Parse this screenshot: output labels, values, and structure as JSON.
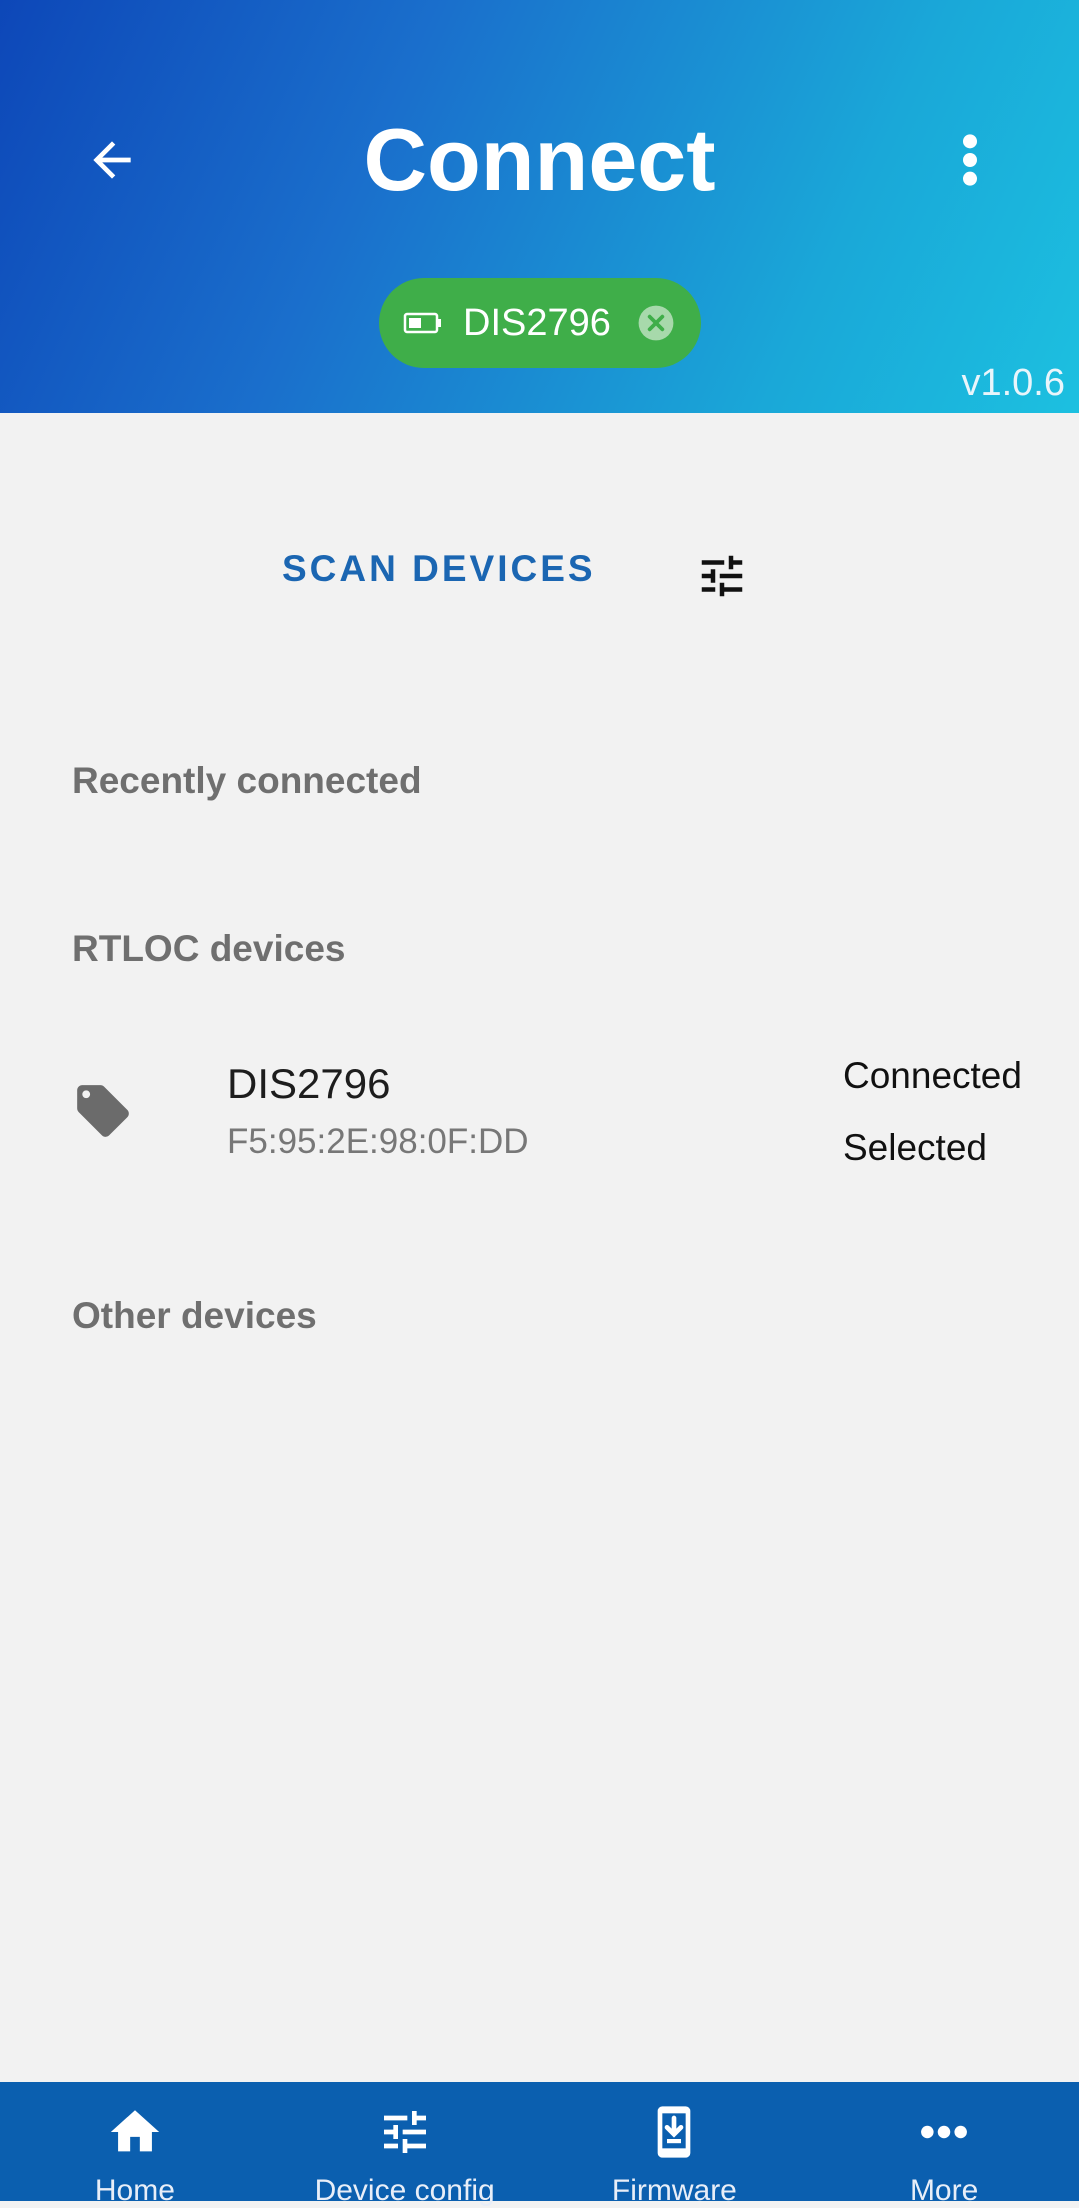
{
  "header": {
    "title": "Connect",
    "chip_label": "DIS2796",
    "version": "v1.0.6"
  },
  "scan": {
    "label": "SCAN DEVICES"
  },
  "sections": {
    "recent": "Recently connected",
    "rtloc": "RTLOC devices",
    "other": "Other devices"
  },
  "devices": [
    {
      "name": "DIS2796",
      "mac": "F5:95:2E:98:0F:DD",
      "status1": "Connected",
      "status2": "Selected"
    }
  ],
  "nav": [
    {
      "label": "Home",
      "icon": "home-icon"
    },
    {
      "label": "Device config",
      "icon": "sliders-icon"
    },
    {
      "label": "Firmware",
      "icon": "phone-download-icon"
    },
    {
      "label": "More",
      "icon": "more-horizontal-icon"
    }
  ],
  "colors": {
    "header_start": "#0d47b8",
    "header_end": "#1cc0e0",
    "chip": "#3fae49",
    "accent": "#1b66b2",
    "nav_bg": "#0b5faf"
  }
}
